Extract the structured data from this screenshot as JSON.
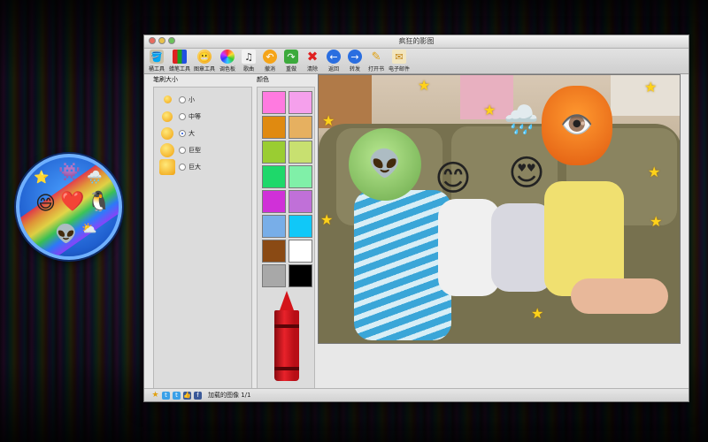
{
  "window": {
    "title": "疯狂的影图"
  },
  "toolbar": {
    "items": [
      {
        "label": "桶工具",
        "icon": "bucket-icon"
      },
      {
        "label": "蜡笔工具",
        "icon": "crayons-icon"
      },
      {
        "label": "图章工具",
        "icon": "stamp-icon"
      },
      {
        "label": "调色板",
        "icon": "color-wheel-icon"
      },
      {
        "label": "歌曲",
        "icon": "music-note-icon"
      },
      {
        "label": "撤消",
        "icon": "undo-icon"
      },
      {
        "label": "重做",
        "icon": "redo-icon"
      },
      {
        "label": "清除",
        "icon": "clear-icon"
      },
      {
        "label": "返回",
        "icon": "back-arrow-icon"
      },
      {
        "label": "转发",
        "icon": "forward-arrow-icon"
      },
      {
        "label": "打开书",
        "icon": "open-book-icon"
      },
      {
        "label": "电子邮件",
        "icon": "email-icon"
      }
    ]
  },
  "brush": {
    "title": "笔刷大小",
    "selected": "大",
    "options": [
      {
        "label": "小"
      },
      {
        "label": "中等"
      },
      {
        "label": "大"
      },
      {
        "label": "巨型"
      },
      {
        "label": "巨大"
      }
    ]
  },
  "colors": {
    "title": "颜色",
    "swatches": [
      "#ff7ae0",
      "#f5a0ec",
      "#e08a10",
      "#e6b060",
      "#9acd32",
      "#c8e070",
      "#1ed86a",
      "#80f0a8",
      "#d030d8",
      "#c070d8",
      "#78aee8",
      "#10c8f8",
      "#8a4a14",
      "#ffffff",
      "#a8a8a8",
      "#000000"
    ],
    "crayon_color": "#d4141a"
  },
  "status": {
    "text": "加载的图像 1/1"
  }
}
